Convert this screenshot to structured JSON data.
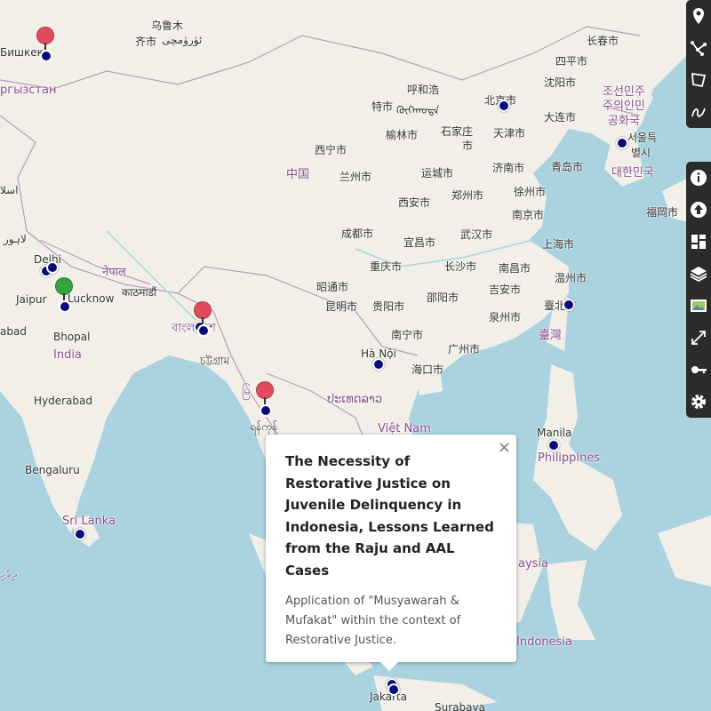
{
  "map": {
    "colors": {
      "water": "#aad3df",
      "land": "#f2efe9",
      "border": "#b99ab9",
      "marker": "#0b0b7a",
      "pin_red": "#e24b5e",
      "pin_green": "#37a33c",
      "toolbar": "#2b2b2b"
    },
    "labels": {
      "bishkek": "Бишкек",
      "kyrgyzstan": "ргызстан",
      "urumqi": "乌鲁木",
      "qi_city": "齐市",
      "urumqi_uyghur": "ئۈرۈمچى",
      "changchun": "长春市",
      "siping": "四平市",
      "shenyang": "沈阳市",
      "dalian": "大连市",
      "hohhot": "呼和浩",
      "te_city": "特市",
      "mongolian": "ᠬᠥᠬᠡᠬᠣᠲᠠ",
      "beijing": "北京市",
      "north_korea_1": "조선민주",
      "north_korea_2": "주의인민",
      "north_korea_3": "공화국",
      "seoul_1": "서울특",
      "seoul_2": "별시",
      "korea": "대한민국",
      "yulin": "榆林市",
      "shijiazhuang_1": "石家庄",
      "shijiazhuang_2": "市",
      "tianjin": "天津市",
      "xining": "西宁市",
      "lanzhou": "兰州市",
      "china": "中国",
      "yuncheng": "运城市",
      "jinan": "济南市",
      "qingdao": "青岛市",
      "fukuoka": "福岡市",
      "xian": "西安市",
      "zhengzhou": "郑州市",
      "xuzhou": "徐州市",
      "nanjing": "南京市",
      "chengdu": "成都市",
      "yichang": "宜昌市",
      "wuhan": "武汉市",
      "shanghai": "上海市",
      "chongqing": "重庆市",
      "changsha": "长沙市",
      "nanchang": "南昌市",
      "wenzhou": "温州市",
      "zhaotong": "昭通市",
      "shaoyang": "邵阳市",
      "jian": "吉安市",
      "kunming": "昆明市",
      "guiyang": "贵阳市",
      "quanzhou": "泉州市",
      "taipei": "臺北市",
      "taiwan": "臺灣",
      "nanning": "南宁市",
      "guangzhou": "广州市",
      "hanoi": "Hà Nội",
      "haikou": "海口市",
      "islamabad": "اسلا",
      "lahore": "لاہور",
      "delhi": "Delhi",
      "nepal": "नेपाल",
      "kathmandu": "काठमाडौं",
      "jaipur": "Jaipur",
      "lucknow": "Lucknow",
      "bhopal": "Bhopal",
      "india": "India",
      "abad": "abad",
      "bangladesh": "বাংলাদেশ",
      "chittagong": "চট্টগ্রাম",
      "myanmar_flag": "မြ",
      "yangon": "ရန်ကုန်",
      "laos": "ປະເທດລາວ",
      "vietnam": "Việt Nam",
      "hyderabad": "Hyderabad",
      "bengaluru": "Bengaluru",
      "sri_lanka": "Sri Lanka",
      "maldives": "ދިވެހި",
      "manila": "Manila",
      "philippines": "Philippines",
      "malaysia": "aysia",
      "indonesia": "Indonesia",
      "jakarta": "Jakarta",
      "surabaya": "Surabaya"
    }
  },
  "toolbar": {
    "tools": [
      "marker-icon",
      "polyline-icon",
      "polygon-icon",
      "freehand-icon"
    ],
    "actions": [
      "info-icon",
      "upload-icon",
      "dashboard-icon",
      "layers-icon",
      "image-icon",
      "resize-icon",
      "key-icon",
      "settings-icon"
    ]
  },
  "popup": {
    "title": "The Necessity of Restorative Justice on Juvenile Delinquency in Indonesia, Lessons Learned from the Raju and AAL Cases",
    "description": "Application of \"Musyawarah & Mufakat\" within the context of Restorative Justice.",
    "close": "×"
  }
}
